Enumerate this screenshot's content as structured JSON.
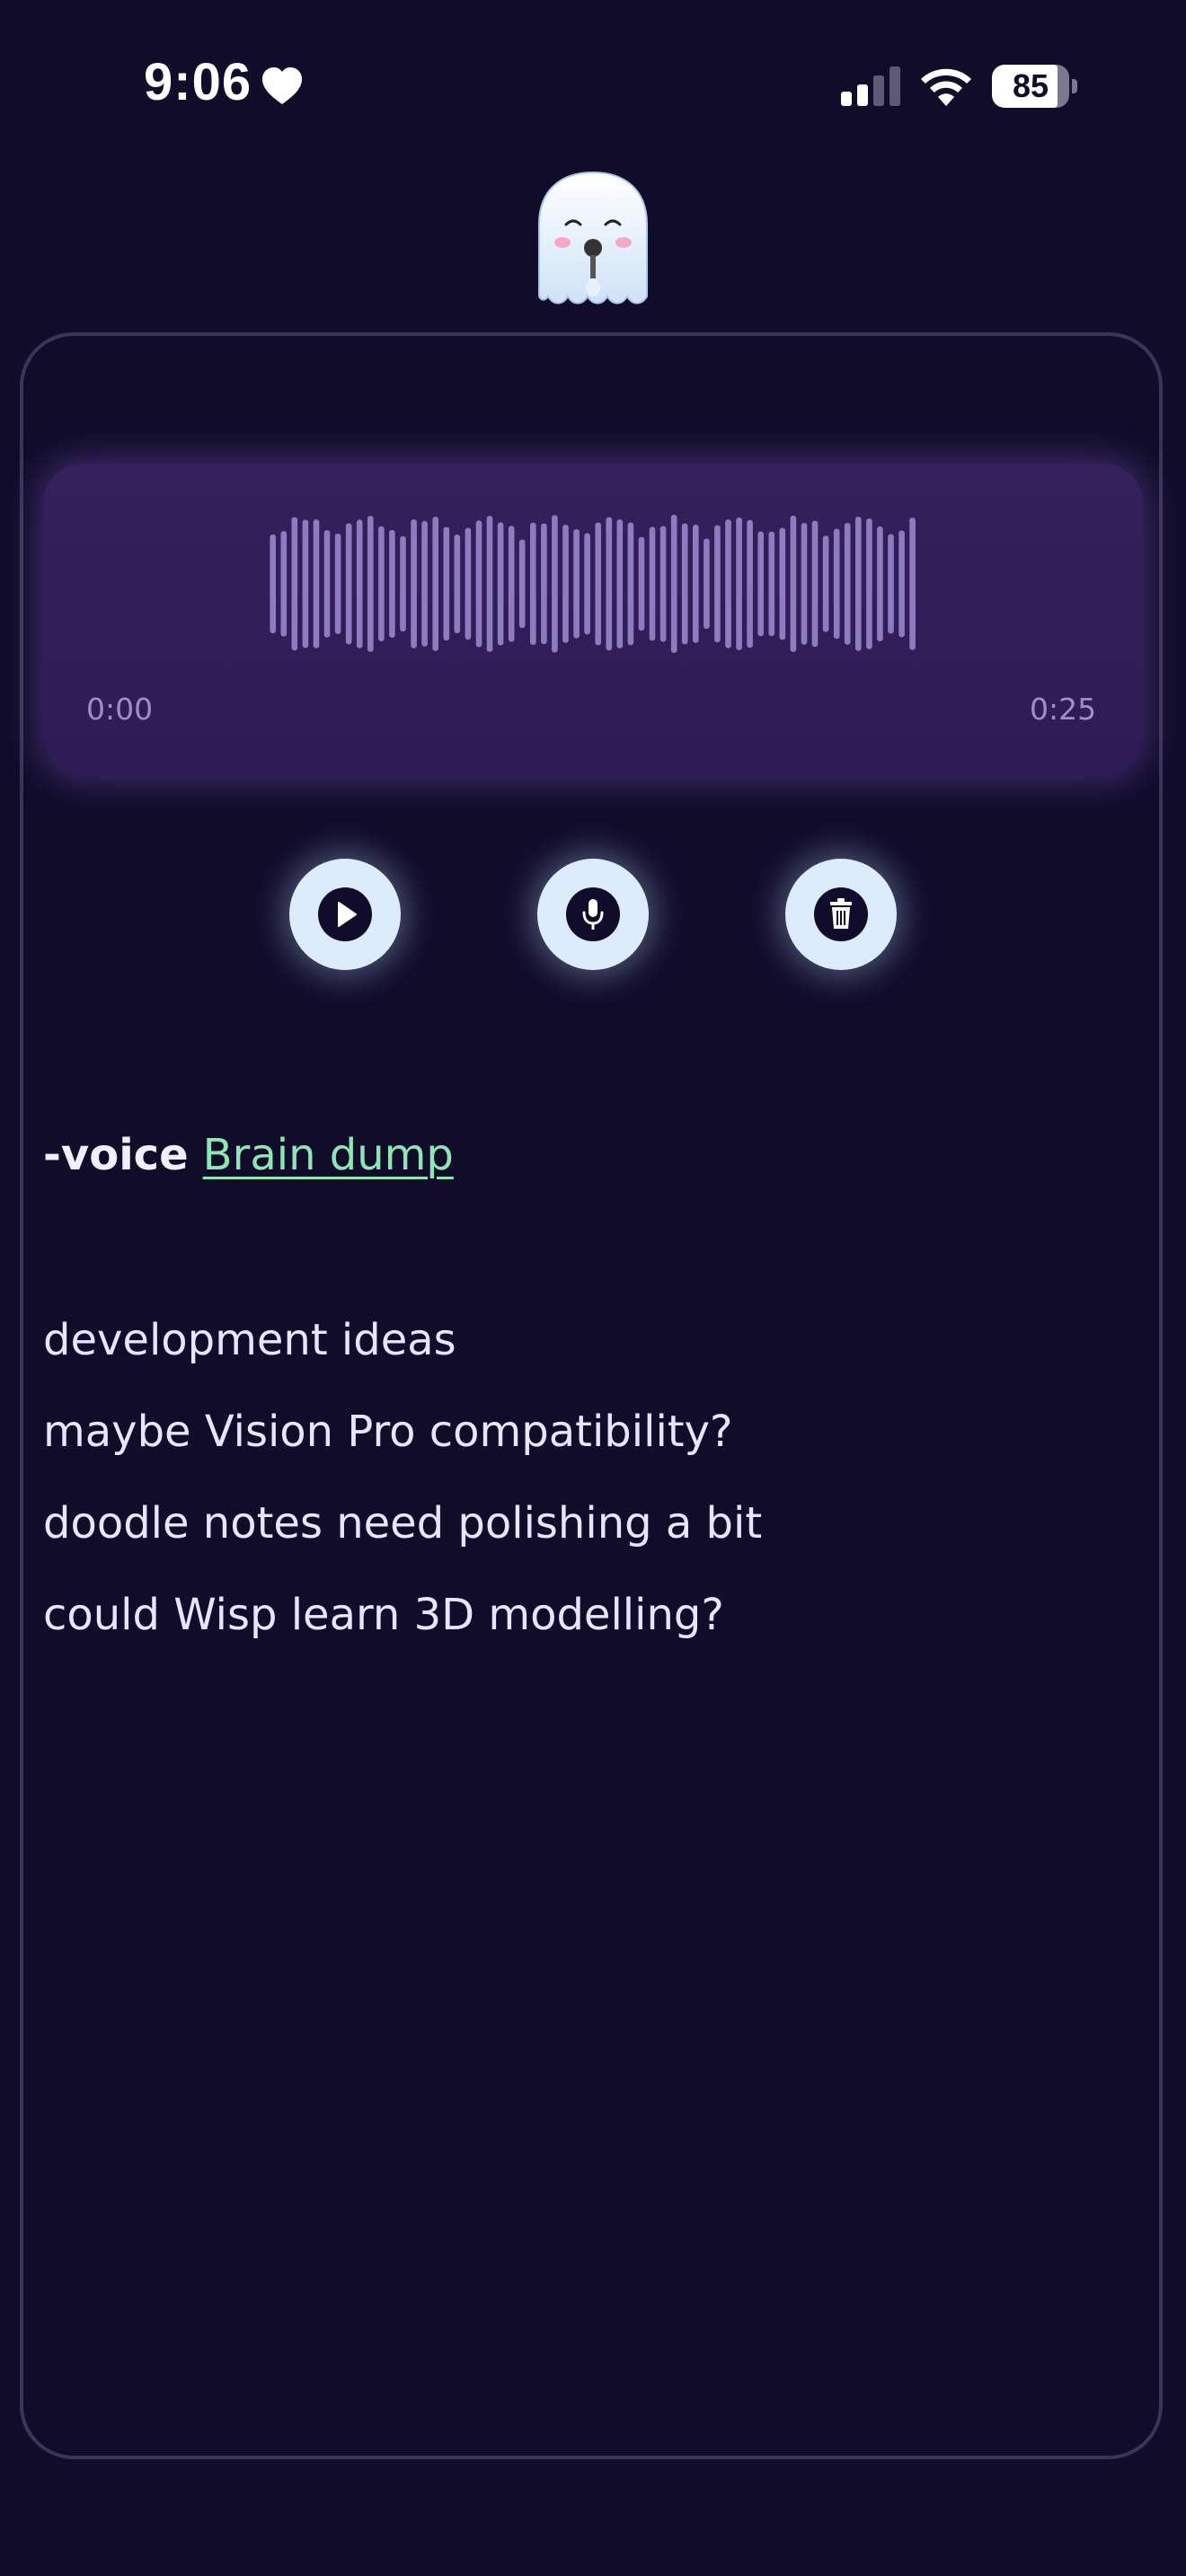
{
  "status_bar": {
    "time": "9:06",
    "battery": "85",
    "battery_level": 0.85,
    "icons": [
      "heart-icon",
      "signal-icon",
      "wifi-icon",
      "battery-icon"
    ]
  },
  "mascot": {
    "icon": "ghost-mascot-icon"
  },
  "player": {
    "current_time": "0:00",
    "duration": "0:25"
  },
  "controls": {
    "play_icon": "play-icon",
    "record_icon": "microphone-icon",
    "delete_icon": "trash-icon"
  },
  "note": {
    "tag": "-voice",
    "link": "Brain dump",
    "lines": [
      "development ideas",
      "maybe Vision Pro compatibility?",
      "doodle notes need polishing a bit",
      "could Wisp learn 3D modelling?"
    ]
  },
  "colors": {
    "background": "#110c2a",
    "player": "#34205a",
    "button": "#dcecfb",
    "link": "#8ee6b4"
  }
}
